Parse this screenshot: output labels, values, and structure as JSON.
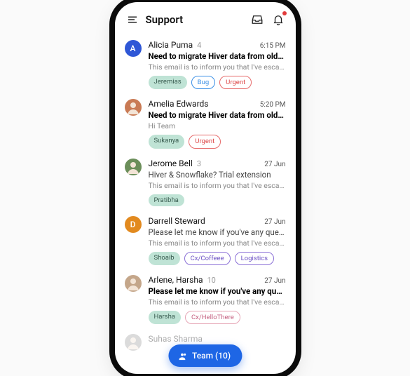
{
  "header": {
    "title": "Support"
  },
  "messages": [
    {
      "sender": "Alicia Puma",
      "count": "4",
      "time": "6:15 PM",
      "subject": "Need to migrate Hiver data from old Gmail…",
      "preview": "This email is to inform you that I've escalated…",
      "unread": true,
      "avatar": {
        "kind": "letter",
        "letter": "A",
        "bg": "#2f57d6"
      },
      "tags": [
        {
          "text": "Jeremias",
          "style": "assignee"
        },
        {
          "text": "Bug",
          "style": "bug"
        },
        {
          "text": "Urgent",
          "style": "urgent"
        }
      ]
    },
    {
      "sender": "Amelia Edwards",
      "count": "",
      "time": "5:20 PM",
      "subject": "Need to migrate Hiver data from old ……",
      "preview": "Hi Team",
      "unread": true,
      "avatar": {
        "kind": "photo",
        "bg": "#c97a54"
      },
      "tags": [
        {
          "text": "Sukanya",
          "style": "assignee"
        },
        {
          "text": "Urgent",
          "style": "urgent"
        }
      ]
    },
    {
      "sender": "Jerome Bell",
      "count": "3",
      "time": "27 Jun",
      "subject": "Hiver & Snowflake? Trial extension",
      "preview": "This email is to inform you that I've escalated…",
      "unread": false,
      "avatar": {
        "kind": "photo",
        "bg": "#6b8e5a"
      },
      "tags": [
        {
          "text": "Pratibha",
          "style": "assignee"
        }
      ]
    },
    {
      "sender": "Darrell Steward",
      "count": "",
      "time": "27 Jun",
      "subject": "Please let me know if you've any questions",
      "preview": "This email is to inform you that I've escalated…",
      "unread": false,
      "avatar": {
        "kind": "letter",
        "letter": "D",
        "bg": "#e28a1f"
      },
      "tags": [
        {
          "text": "Shoaib",
          "style": "assignee"
        },
        {
          "text": "Cx/Coffeee",
          "style": "purple"
        },
        {
          "text": "Logistics",
          "style": "purple"
        }
      ]
    },
    {
      "sender": "Arlene, Harsha",
      "count": "10",
      "time": "27 Jun",
      "subject": "Please let me know if you've any questions",
      "preview": "This email is to inform you that I've escalated…",
      "unread": true,
      "avatar": {
        "kind": "photo",
        "bg": "#c4a68a"
      },
      "tags": [
        {
          "text": "Harsha",
          "style": "assignee"
        },
        {
          "text": "Cx/HelloThere",
          "style": "pink"
        }
      ]
    },
    {
      "sender": "Suhas Sharma",
      "count": "",
      "time": "",
      "subject": "",
      "preview": "",
      "unread": false,
      "faded": true,
      "avatar": {
        "kind": "photo",
        "bg": "#999"
      },
      "tags": []
    }
  ],
  "fab": {
    "label": "Team (10)"
  }
}
